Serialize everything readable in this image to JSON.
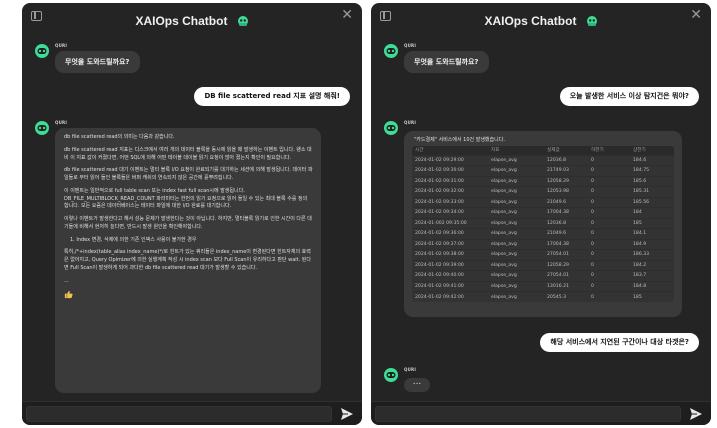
{
  "app": {
    "title": "XAIOps Chatbot",
    "brand_icon": "xaiops-logo-icon",
    "accent_color": "#3ddc97"
  },
  "left_panel": {
    "messages": [
      {
        "role": "bot",
        "sender": "QURI",
        "text": "무엇을 도와드릴까요?"
      },
      {
        "role": "user",
        "text": "DB file scattered read 지표 설명 해줘!"
      },
      {
        "role": "bot",
        "sender": "QURI",
        "paragraphs": [
          "db file scattered read의 의미는 다음과 같습니다.",
          "db file scattered read 지표는 디스크에서 여러 개의 데이터 블록을 동시에 읽을 때 발생하는 이벤트 입니다. 왱소 대비 이 지표 값이 커졌다면, 어떤 SQL에 의해 어떤 테이블 데이블 읽기 요청이 많아 졌는지 확인이 필요합니다.",
          "db file scattered read 대기 이벤트는 멀티 블록 I/O 요청이 완료되기를 대기하는 세션에 의해 발생됩니다. 데이터 파일들로 부터 읽어 들인 블록들은 버퍼 캐쉬의 연속되지 않은 공간에 흩뿌려집니다.",
          "이 이벤트는 일반적으로 full table scan 또는 index fast full scan시에 발생됩니다. DB_FILE_MULTIBLOCK_READ_COUNT 파라미터는 한번의 읽기 요청으로 읽어 들일 수 있는 최대 블록 수를 정의 합니다. 모든 요즘은 데이터베이스는 테이터 파일에 대한 I/O 완료를 대기합니다.",
          "이렇나 이벤트가 발생한다고 해서 성능 문제가 발생한다는 것이 아닙니다. 하지만, 멀티블록 읽기로 인한 시간이 다른 대기들에 비해서 현저히 늘다면, 반드시 발생 원인을 확인해야합니다.",
          "1. Index 변경, 삭제에 의한 기존 인덱스 사용이 불가한 경우",
          "특히,/*+index(table_alias index_name)*/로 힌트가 있는 쿼리들은 index_name이 변경된다면 힌트자체의 효력은 없어지고, Query Opimizer에 의한 실행계획 작성 시 index scan 보다 Full Scan이 유리하다고 판단 wait. 된다면 Full Scan이 발생하게 되어 과다한 db file scattered read 대기가 발생할 수 있습니다.",
          "..."
        ]
      }
    ],
    "reaction_icon": "thumbs-up-icon"
  },
  "right_panel": {
    "messages": [
      {
        "role": "bot",
        "sender": "QURI",
        "text": "무엇을 도와드릴까요?"
      },
      {
        "role": "user",
        "text": "오늘 발생한 서비스 이상 탐지건은 뭐야?"
      },
      {
        "role": "bot",
        "sender": "QURI",
        "text": "\"카드결제\" 서비스에서 10건 발생했습니다."
      },
      {
        "role": "user",
        "text": "해당 서비스에서 지연된 구간이나 대상 타겟은?"
      },
      {
        "role": "bot",
        "sender": "QURI",
        "text": "..."
      }
    ],
    "table": {
      "headers": [
        "시간",
        "지표",
        "실제값",
        "하한기",
        "상한기"
      ],
      "rows": [
        [
          "2024-01-02 09:29:00",
          "elapse_avg",
          "12036.8",
          "0",
          "184.6"
        ],
        [
          "2024-01-02 09:30:00",
          "elapse_avg",
          "21749.03",
          "0",
          "184.75"
        ],
        [
          "2024-01-02 09:31:00",
          "elapse_avg",
          "12058.29",
          "0",
          "185.6"
        ],
        [
          "2024-01-02 09:32:00",
          "elapse_avg",
          "12053.98",
          "0",
          "185.31"
        ],
        [
          "2024-01-02 09:33:00",
          "elapse_avg",
          "21049.6",
          "0",
          "185.56"
        ],
        [
          "2024-01-02 09:34:00",
          "elapse_avg",
          "17004.38",
          "0",
          "184"
        ],
        [
          "2024-01-002 09:35:00",
          "elapse_avg",
          "12036.8",
          "0",
          "185"
        ],
        [
          "2024-01-02 09:36:00",
          "elapse_avg",
          "21049.6",
          "0",
          "184.1"
        ],
        [
          "2024-01-02 09:37:00",
          "elapse_avg",
          "17004.38",
          "0",
          "184.9"
        ],
        [
          "2024-01-02 09:38:00",
          "elapse_avg",
          "27054.01",
          "0",
          "186.33"
        ],
        [
          "2024-01-02 09:39:00",
          "elapse_avg",
          "12058.29",
          "0",
          "184.2"
        ],
        [
          "2024-01-02 09:40:00",
          "elapse_avg",
          "27054.01",
          "0",
          "183.7"
        ],
        [
          "2024-01-02 09:41:00",
          "elapse_avg",
          "13016.21",
          "0",
          "184.8"
        ],
        [
          "2024-01-02 09:42:00",
          "elapse_avg",
          "20545.3",
          "0",
          "185"
        ]
      ]
    }
  },
  "input": {
    "value": "",
    "placeholder": "",
    "send_icon": "send-icon"
  }
}
